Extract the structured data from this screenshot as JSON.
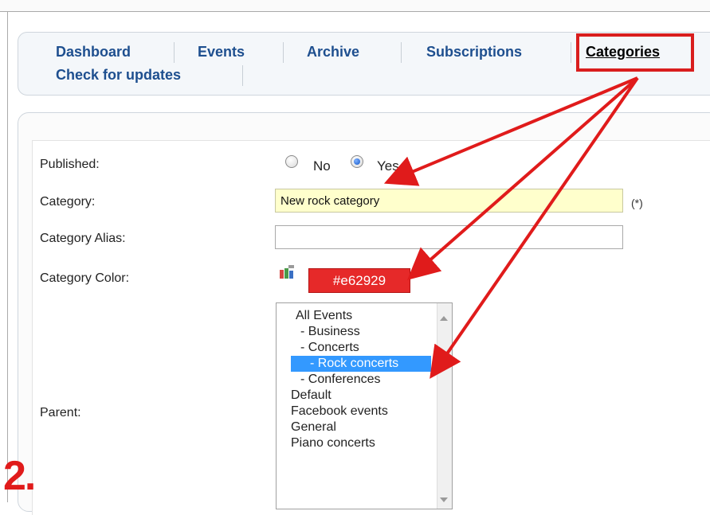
{
  "nav": {
    "tabs": [
      {
        "label": "Dashboard"
      },
      {
        "label": "Events"
      },
      {
        "label": "Archive"
      },
      {
        "label": "Subscriptions"
      },
      {
        "label": "Categories"
      },
      {
        "label": "Check for updates"
      }
    ]
  },
  "form": {
    "published": {
      "label": "Published:",
      "options": [
        "No",
        "Yes"
      ],
      "selected": "Yes"
    },
    "category": {
      "label": "Category:",
      "value": "New rock category",
      "required_mark": "(*)"
    },
    "alias": {
      "label": "Category Alias:",
      "value": ""
    },
    "color": {
      "label": "Category Color:",
      "value": "#e62929"
    },
    "parent": {
      "label": "Parent:",
      "options": [
        "All Events",
        " - Business",
        " - Concerts",
        "  - Rock concerts",
        " - Conferences",
        "Default",
        "Facebook events",
        "General",
        "Piano concerts"
      ],
      "selected": "  - Rock concerts"
    }
  },
  "step_marker": "2.",
  "colors": {
    "annotation_red": "#e01b1b",
    "tab_text": "#1e4f8f",
    "selected_row": "#3399ff"
  }
}
